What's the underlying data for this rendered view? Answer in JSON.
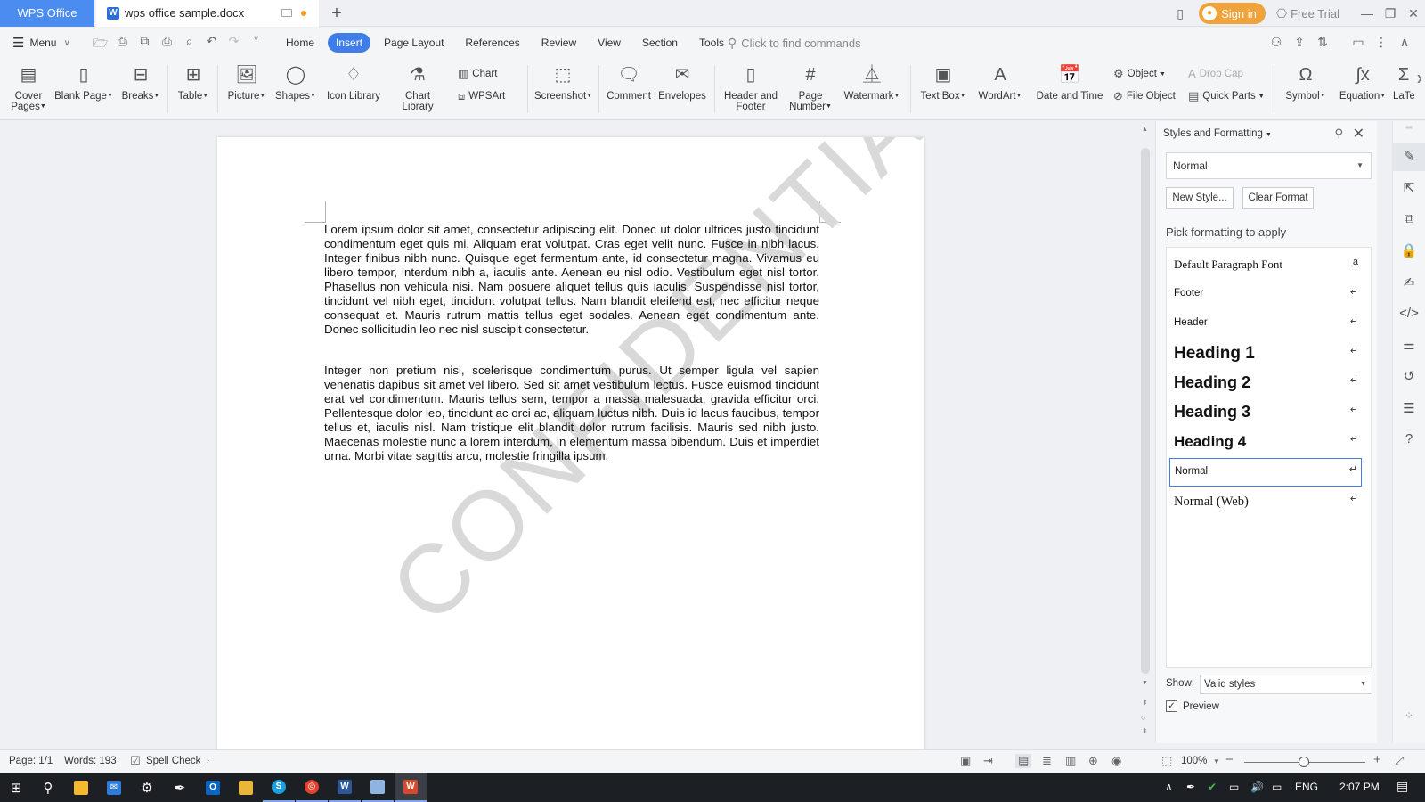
{
  "titlebar": {
    "app_tab": "WPS Office",
    "doc_tab": "wps office sample.docx",
    "sign_in": "Sign in",
    "free_trial": "Free Trial"
  },
  "menubar": {
    "menu_label": "Menu",
    "tabs": [
      "Home",
      "Insert",
      "Page Layout",
      "References",
      "Review",
      "View",
      "Section",
      "Tools"
    ],
    "active_tab": "Insert",
    "find_placeholder": "Click to find commands"
  },
  "ribbon": {
    "cover_pages": "Cover Pages",
    "cover_pages_l1": "Cover",
    "cover_pages_l2": "Pages",
    "blank_page": "Blank Page",
    "breaks": "Breaks",
    "table": "Table",
    "picture": "Picture",
    "shapes": "Shapes",
    "icon_library": "Icon Library",
    "chart_library": "Chart Library",
    "chart": "Chart",
    "wpsart": "WPSArt",
    "screenshot": "Screenshot",
    "comment": "Comment",
    "envelopes": "Envelopes",
    "header_footer_l1": "Header and",
    "header_footer_l2": "Footer",
    "page_number_l1": "Page",
    "page_number_l2": "Number",
    "watermark": "Watermark",
    "text_box": "Text Box",
    "wordart": "WordArt",
    "date_time": "Date and Time",
    "object": "Object",
    "file_object": "File Object",
    "drop_cap": "Drop Cap",
    "quick_parts": "Quick Parts",
    "symbol": "Symbol",
    "equation": "Equation",
    "latex": "LaTe"
  },
  "document": {
    "paragraph1": "Lorem ipsum dolor sit amet, consectetur adipiscing elit. Donec ut dolor ultrices justo tincidunt condimentum eget quis mi. Aliquam erat volutpat. Cras eget velit nunc. Fusce in nibh lacus. Integer finibus nibh nunc. Quisque eget fermentum ante, id consectetur magna. Vivamus eu libero tempor, interdum nibh a, iaculis ante. Aenean eu nisl odio. Vestibulum eget nisl tortor. Phasellus non vehicula nisi. Nam posuere aliquet tellus quis iaculis. Suspendisse nisl tortor, tincidunt vel nibh eget, tincidunt volutpat tellus. Nam blandit eleifend est, nec efficitur neque consequat et. Mauris rutrum mattis tellus eget sodales. Aenean eget condimentum ante. Donec sollicitudin leo nec nisl suscipit consectetur.",
    "paragraph2": "Integer non pretium nisi, scelerisque condimentum purus. Ut semper ligula vel sapien venenatis dapibus sit amet vel libero. Sed sit amet vestibulum lectus. Fusce euismod tincidunt erat vel condimentum. Mauris tellus sem, tempor a massa malesuada, gravida efficitur orci. Pellentesque dolor leo, tincidunt ac orci ac, aliquam luctus nibh. Duis id lacus faucibus, tempor tellus et, iaculis nisl. Nam tristique elit blandit dolor rutrum facilisis. Mauris sed nibh justo. Maecenas molestie nunc a lorem interdum, in elementum massa bibendum. Duis et imperdiet urna. Morbi vitae sagittis arcu, molestie fringilla ipsum.",
    "watermark_text": "CONFIDENTIAL"
  },
  "styles_panel": {
    "title": "Styles and Formatting",
    "current_style": "Normal",
    "new_style": "New Style...",
    "clear_format": "Clear Format",
    "pick_label": "Pick formatting to apply",
    "styles": [
      {
        "name": "Default Paragraph Font",
        "marker": "a"
      },
      {
        "name": "Footer",
        "marker": "↵"
      },
      {
        "name": "Header",
        "marker": "↵"
      },
      {
        "name": "Heading 1",
        "marker": "↵"
      },
      {
        "name": "Heading 2",
        "marker": "↵"
      },
      {
        "name": "Heading 3",
        "marker": "↵"
      },
      {
        "name": "Heading 4",
        "marker": "↵"
      },
      {
        "name": "Normal",
        "marker": "↵"
      },
      {
        "name": "Normal (Web)",
        "marker": "↵"
      }
    ],
    "selected_style": "Normal",
    "show_label": "Show:",
    "show_value": "Valid styles",
    "preview_label": "Preview",
    "preview_checked": true
  },
  "statusbar": {
    "page": "Page: 1/1",
    "words": "Words: 193",
    "spell_check": "Spell Check",
    "zoom": "100%"
  },
  "taskbar": {
    "language": "ENG",
    "time": "2:07 PM"
  },
  "colors": {
    "accent": "#3f7ee8",
    "app_tab": "#4a8cf0",
    "sign_in": "#f0a33a",
    "watermark": "#d9d9d9"
  }
}
